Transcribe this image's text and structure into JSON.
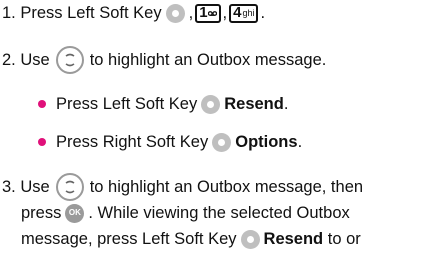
{
  "steps": {
    "s1": {
      "num": "1.",
      "a": "Press Left Soft Key",
      "sep": ",",
      "key1": "1",
      "key2": "4",
      "key2_sub": "ghi",
      "end": "."
    },
    "s2": {
      "num": "2.",
      "a": "Use",
      "b": "to highlight an Outbox message."
    },
    "b1": {
      "a": "Press Left Soft Key",
      "action": "Resend",
      "end": "."
    },
    "b2": {
      "a": "Press Right Soft Key",
      "action": "Options",
      "end": "."
    },
    "s3": {
      "num": "3.",
      "a": "Use",
      "b": "to highlight an Outbox message, then",
      "c": "press",
      "d": ". While viewing the selected Outbox",
      "e": "message, press Left Soft Key",
      "action": "Resend",
      "f": "to or"
    }
  },
  "icons": {
    "softkey": "left-soft-key-icon",
    "nav": "navigation-key-icon",
    "ok": "ok-key-icon",
    "ok_label": "OK",
    "bullet_color": "#e0117a"
  }
}
